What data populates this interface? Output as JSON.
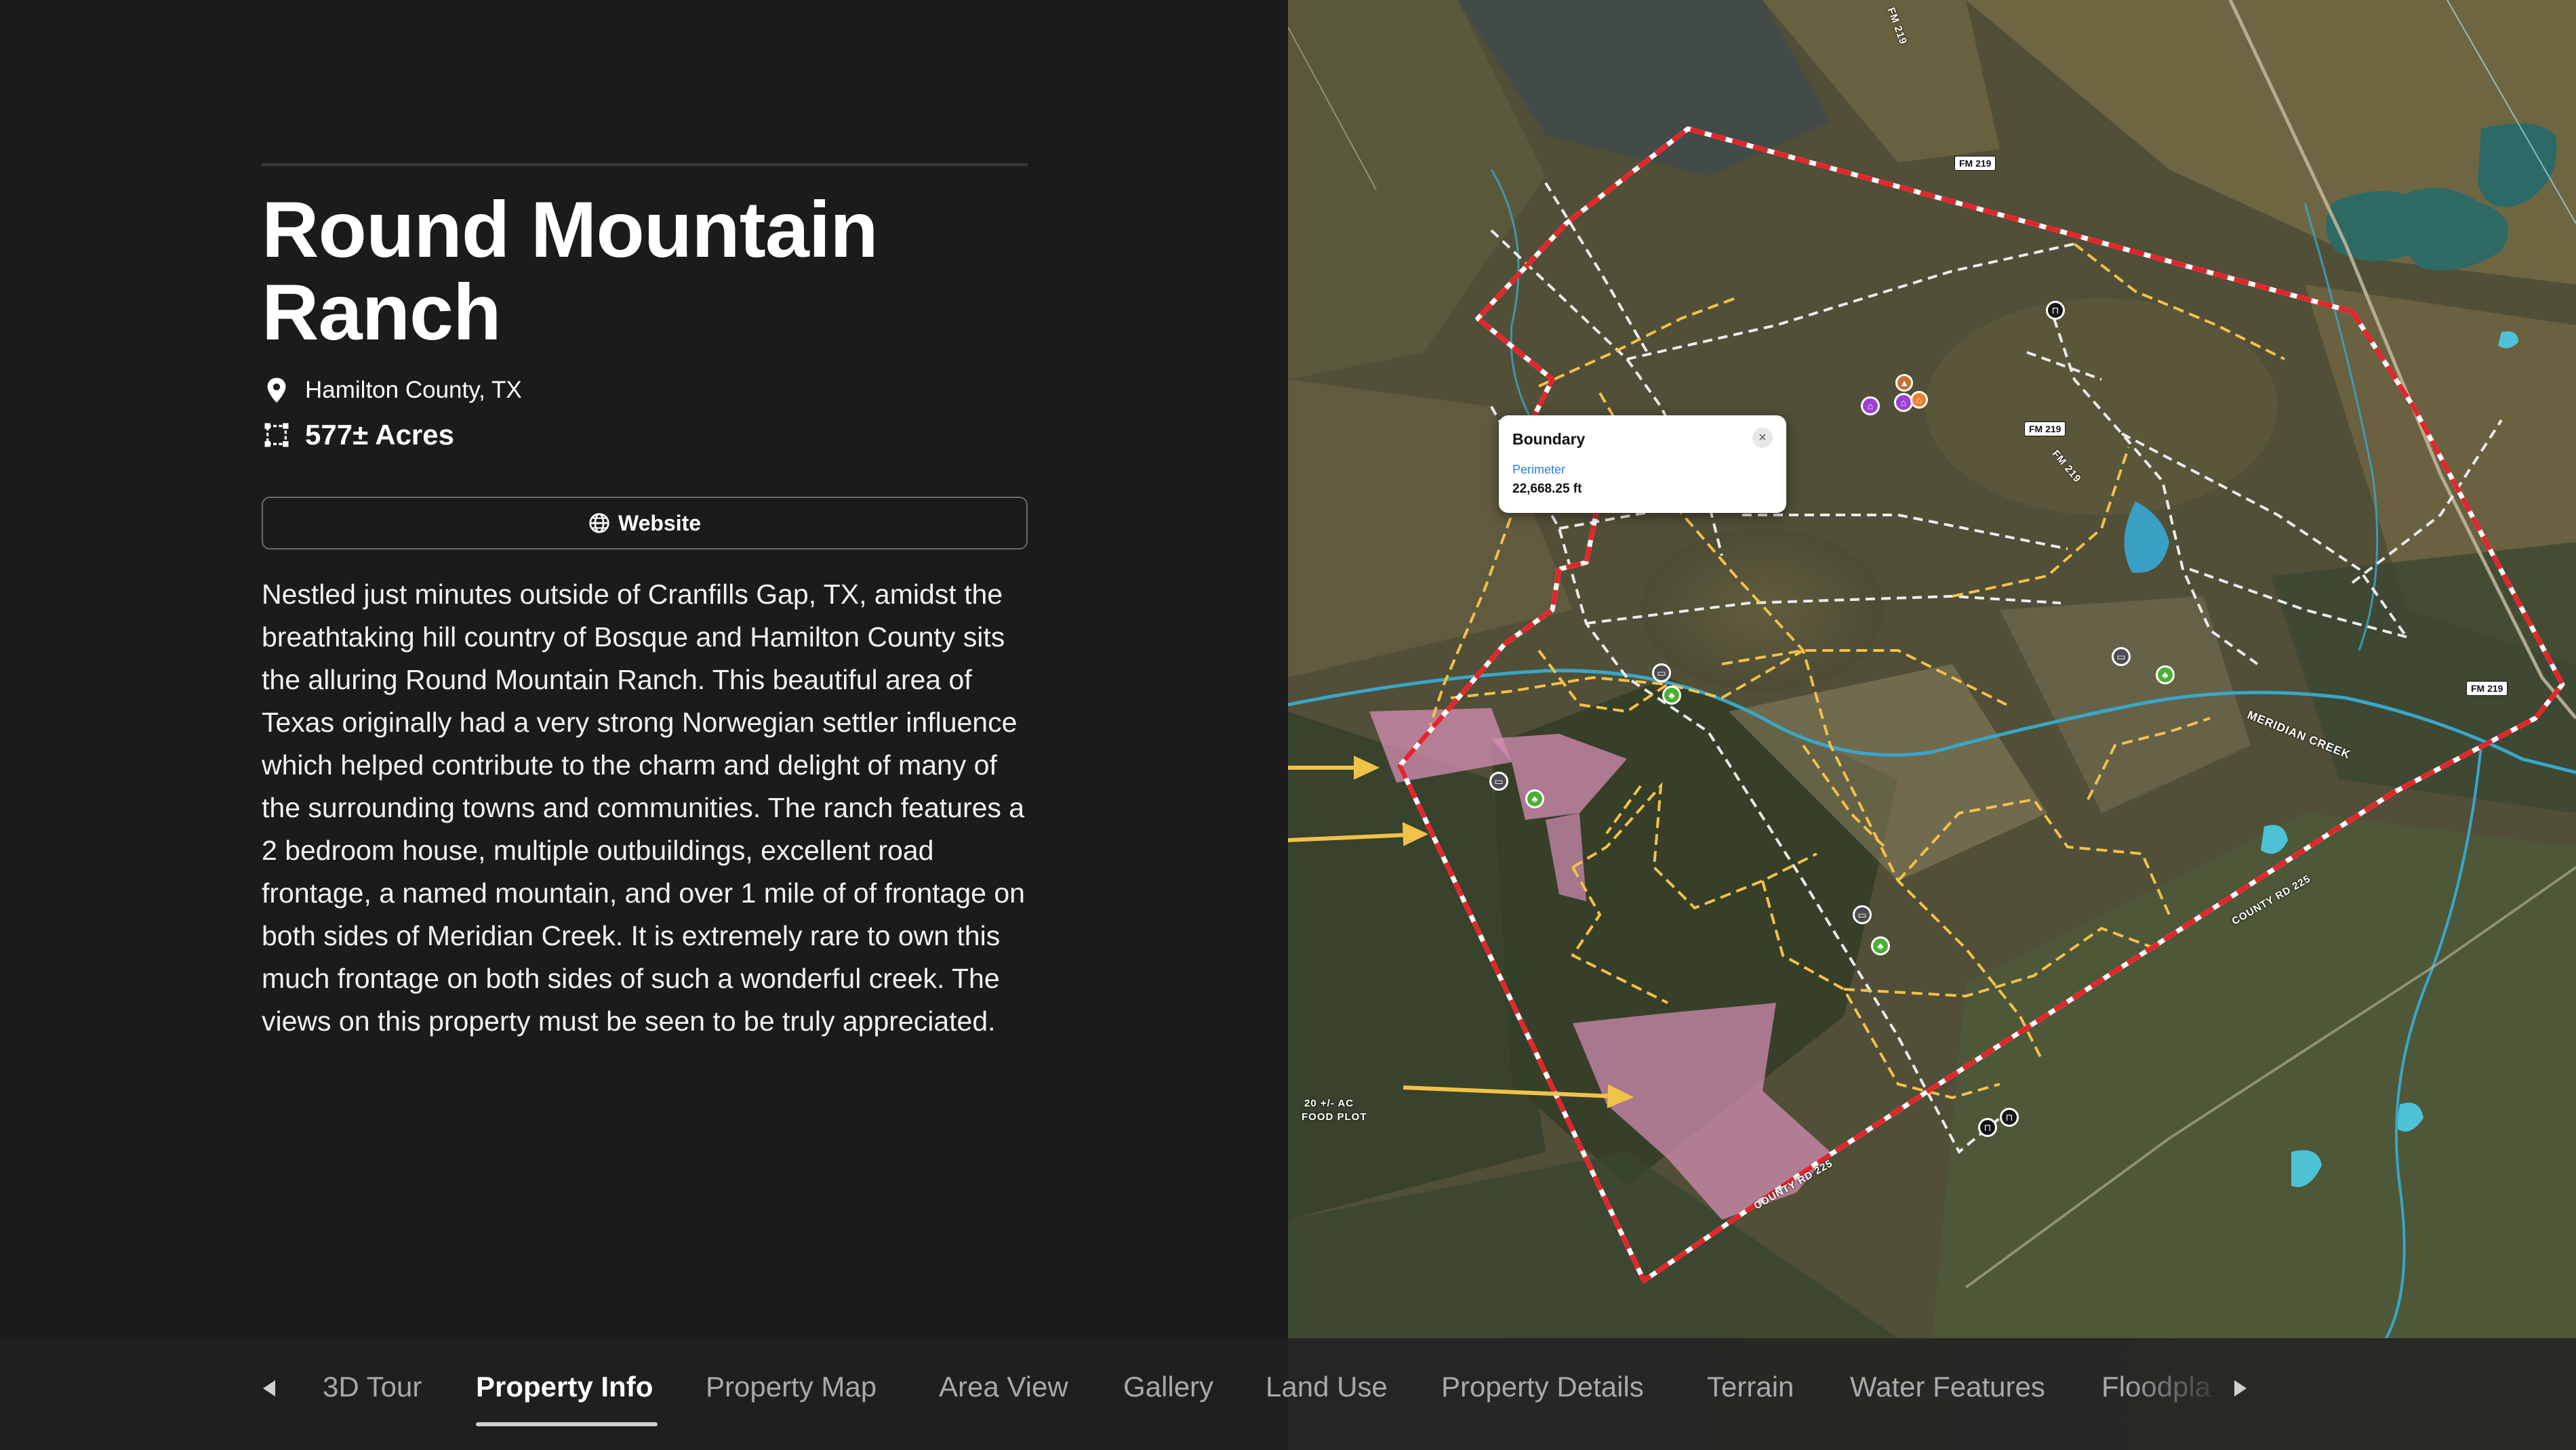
{
  "property": {
    "title": "Round Mountain Ranch",
    "location": "Hamilton County, TX",
    "acres": "577± Acres",
    "website_label": "Website",
    "description": "Nestled just minutes outside of Cranfills Gap, TX, amidst the breathtaking hill country of Bosque and Hamilton County sits the alluring Round Mountain Ranch. This beautiful area of Texas originally had a very strong Norwegian settler influence which helped contribute to the charm and delight of many of the surrounding towns and communities. The ranch features a 2 bedroom house, multiple outbuildings, excellent road frontage, a named mountain, and over 1 mile of of frontage on both sides of Meridian Creek. It is extremely rare to own this much frontage on both sides of such a wonderful creek. The views on this property must be seen to be truly appreciated."
  },
  "map": {
    "popup": {
      "title": "Boundary",
      "close_symbol": "×",
      "label": "Perimeter",
      "value": "22,668.25 ft"
    },
    "road_labels": [
      "FM 219",
      "FM 219",
      "FM 219",
      "FM 219",
      "FM 219"
    ],
    "creek_label": "MERIDIAN CREEK",
    "county_road_labels": [
      "COUNTY RD 225",
      "COUNTY RD 225"
    ],
    "food_plot_label_line1": "20 +/- AC",
    "food_plot_label_line2": "FOOD PLOT",
    "colors": {
      "boundary": "#e8242b",
      "trail": "#f2c14a",
      "fence": "#e9e9e9",
      "creek": "#3aa6c9",
      "food_plot": "#d58fb6"
    },
    "icons": [
      "house-icon",
      "barn-icon",
      "feeder-icon",
      "stand-icon",
      "gate-icon",
      "blind-icon"
    ]
  },
  "tabs": {
    "items": [
      {
        "label": "3D Tour"
      },
      {
        "label": "Property Info"
      },
      {
        "label": "Property Map"
      },
      {
        "label": "Area View"
      },
      {
        "label": "Gallery"
      },
      {
        "label": "Land Use"
      },
      {
        "label": "Property Details"
      },
      {
        "label": "Terrain"
      },
      {
        "label": "Water Features"
      },
      {
        "label": "Floodpla"
      }
    ],
    "active": "Property Info"
  }
}
